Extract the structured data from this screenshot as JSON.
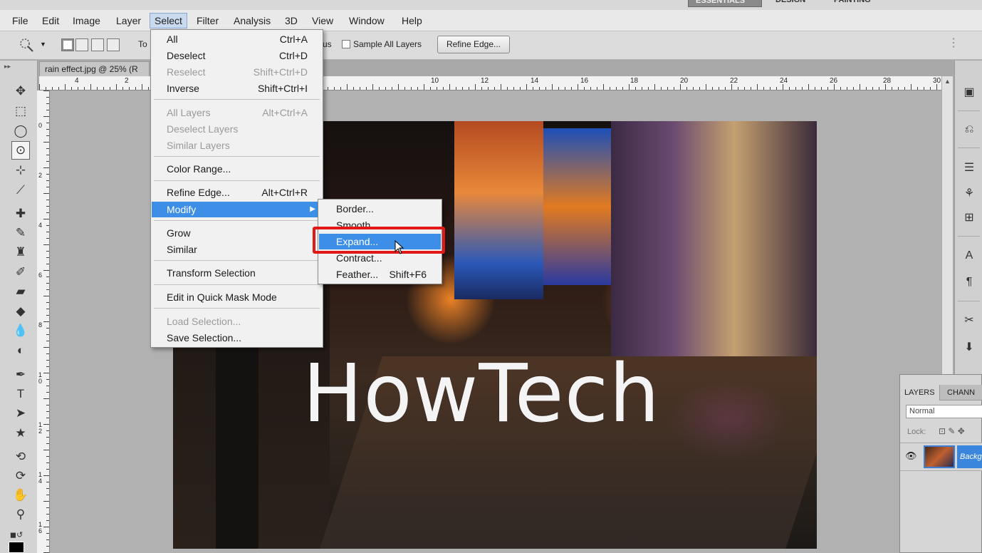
{
  "workspaces": [
    "ESSENTIALS",
    "DESIGN",
    "PAINTING"
  ],
  "menubar": [
    "File",
    "Edit",
    "Image",
    "Layer",
    "Select",
    "Filter",
    "Analysis",
    "3D",
    "View",
    "Window",
    "Help"
  ],
  "options": {
    "to_label": "To",
    "us_label": "us",
    "sample_all_layers": "Sample All Layers",
    "refine_edge": "Refine Edge..."
  },
  "document": {
    "tab_title": "rain effect.jpg @ 25% (R",
    "ruler_h": [
      "4",
      "2",
      "",
      "10",
      "12",
      "14",
      "16",
      "18",
      "20",
      "22",
      "24",
      "26",
      "28",
      "30"
    ],
    "ruler_v": [
      "0",
      "2",
      "4",
      "6",
      "8",
      "1\n0",
      "1\n2",
      "1\n4",
      "1\n6"
    ],
    "text_layer": "HowTech"
  },
  "select_menu": [
    {
      "label": "All",
      "shortcut": "Ctrl+A",
      "disabled": false
    },
    {
      "label": "Deselect",
      "shortcut": "Ctrl+D",
      "disabled": false
    },
    {
      "label": "Reselect",
      "shortcut": "Shift+Ctrl+D",
      "disabled": true
    },
    {
      "label": "Inverse",
      "shortcut": "Shift+Ctrl+I",
      "disabled": false
    },
    {
      "label": "All Layers",
      "shortcut": "Alt+Ctrl+A",
      "disabled": true
    },
    {
      "label": "Deselect Layers",
      "shortcut": "",
      "disabled": true
    },
    {
      "label": "Similar Layers",
      "shortcut": "",
      "disabled": true
    },
    {
      "label": "Color Range...",
      "shortcut": "",
      "disabled": false
    },
    {
      "label": "Refine Edge...",
      "shortcut": "Alt+Ctrl+R",
      "disabled": false
    },
    {
      "label": "Modify",
      "shortcut": "",
      "disabled": false
    },
    {
      "label": "Grow",
      "shortcut": "",
      "disabled": false
    },
    {
      "label": "Similar",
      "shortcut": "",
      "disabled": false
    },
    {
      "label": "Transform Selection",
      "shortcut": "",
      "disabled": false
    },
    {
      "label": "Edit in Quick Mask Mode",
      "shortcut": "",
      "disabled": false
    },
    {
      "label": "Load Selection...",
      "shortcut": "",
      "disabled": true
    },
    {
      "label": "Save Selection...",
      "shortcut": "",
      "disabled": false
    }
  ],
  "modify_submenu": [
    {
      "label": "Border...",
      "shortcut": ""
    },
    {
      "label": "Smooth...",
      "shortcut": ""
    },
    {
      "label": "Expand...",
      "shortcut": ""
    },
    {
      "label": "Contract...",
      "shortcut": ""
    },
    {
      "label": "Feather...",
      "shortcut": "Shift+F6"
    }
  ],
  "layers_panel": {
    "tabs": [
      "LAYERS",
      "CHANN"
    ],
    "blend_mode": "Normal",
    "lock_label": "Lock:",
    "layer_name": "Backg"
  },
  "colors": {
    "highlight": "#3d8ee6",
    "annotation_red": "#e01818"
  }
}
